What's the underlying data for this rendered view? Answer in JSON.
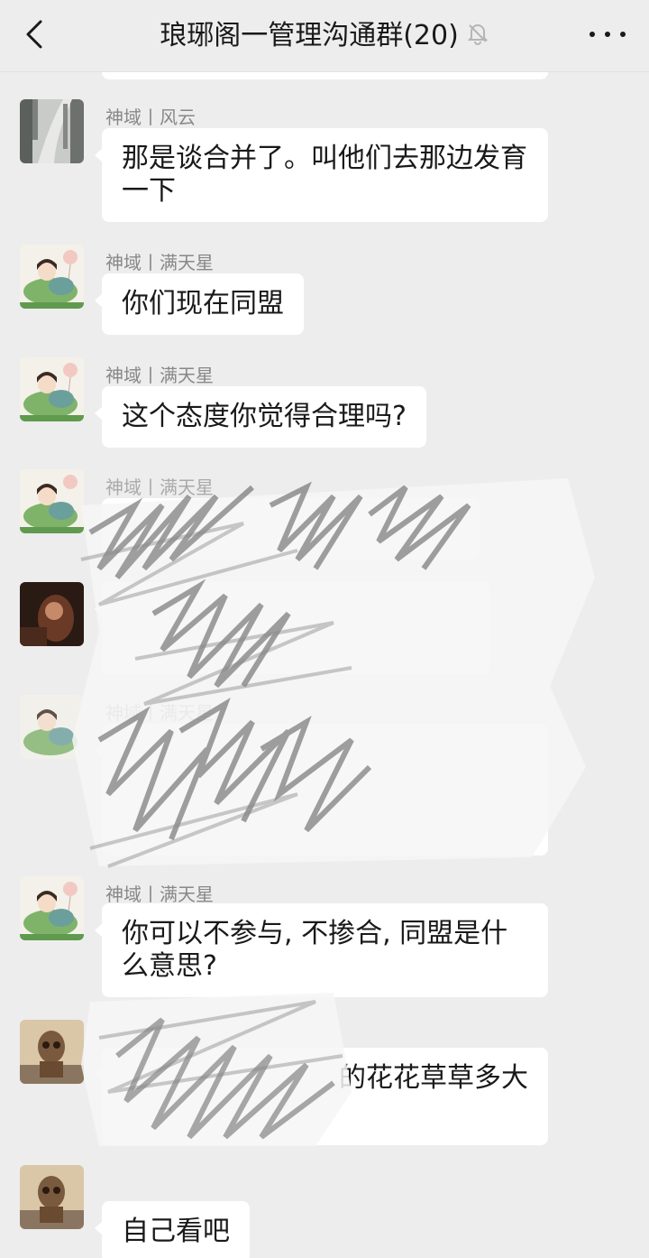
{
  "header": {
    "title": "琅琊阁一管理沟通群(20)",
    "back_icon": "chevron-left-icon",
    "mute_icon": "bell-off-icon",
    "more_icon": "more-dots-icon"
  },
  "messages": [
    {
      "sender": "神域丨风云",
      "text": "那是谈合并了。叫他们去那边发育一下",
      "avatar": "forest-avatar"
    },
    {
      "sender": "神域丨满天星",
      "text": "你们现在同盟",
      "avatar": "girl-avatar"
    },
    {
      "sender": "神域丨满天星",
      "text": "这个态度你觉得合理吗?",
      "avatar": "girl-avatar"
    },
    {
      "sender": "神域丨满天星",
      "text": "",
      "avatar": "girl-avatar",
      "redacted": true
    },
    {
      "sender": "",
      "text": "",
      "avatar": "dark-avatar",
      "redacted": true
    },
    {
      "sender": "神域丨满天星",
      "text": "",
      "avatar": "girl-avatar",
      "redacted": true
    },
    {
      "sender": "神域丨满天星",
      "text": "你可以不参与, 不掺合, 同盟是什么意思?",
      "avatar": "girl-avatar"
    },
    {
      "sender": "",
      "text": "的花花草草多大",
      "avatar": "groot-avatar",
      "partially_redacted": true
    },
    {
      "sender": "",
      "text": "自己看吧",
      "avatar": "groot-avatar"
    }
  ]
}
